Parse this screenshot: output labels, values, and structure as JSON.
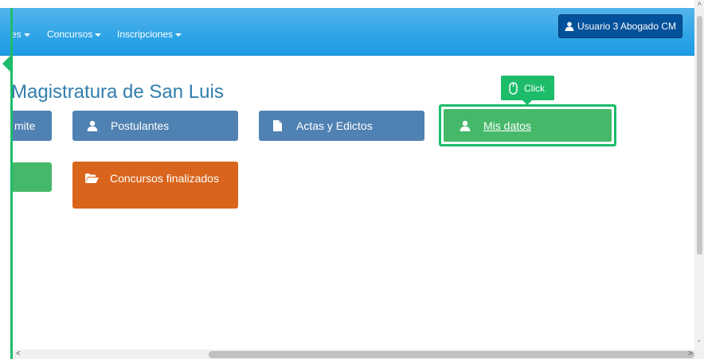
{
  "navbar": {
    "items": [
      {
        "label": "es"
      },
      {
        "label": "Concursos"
      },
      {
        "label": "Inscripciones"
      }
    ],
    "user_button_label": "Usuario 3 Abogado CM"
  },
  "page": {
    "title": "Magistratura de San Luis"
  },
  "tiles": {
    "tramite": "mite",
    "postulantes": "Postulantes",
    "actas": "Actas y Edictos",
    "mis_datos": "Mis datos",
    "concursos_finalizados": "Concursos finalizados"
  },
  "tooltip": {
    "label": "Click"
  },
  "colors": {
    "navbar": "#2fa4e7",
    "user_button": "#04519b",
    "title": "#317eac",
    "tile_blue": "#4f81b2",
    "tile_green": "#46b86a",
    "tile_orange": "#d9641c",
    "highlight": "#1cbc6a"
  },
  "icons": {
    "user": "user-icon",
    "document": "document-icon",
    "folder": "folder-open-icon",
    "mouse": "mouse-icon"
  }
}
